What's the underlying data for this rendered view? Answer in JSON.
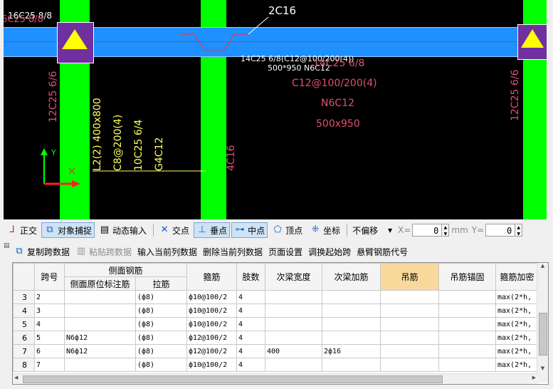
{
  "cad": {
    "top_left_label": "16C25 8/8",
    "top_left_label2": "6C25 8/8",
    "beam_callout": "2C16",
    "beam_dim_white1": "14C25 6/8(C12@100/200(4))",
    "beam_dim_white2": "500*950 N6C12",
    "beam_red1": "14C25 6/8",
    "beam_red2": "C12@100/200(4)",
    "beam_red3": "N6C12",
    "beam_red4": "500x950",
    "col_left_label": "12C25 6/6",
    "col_right_label": "12C25 6/6",
    "col_mid_label": "4C16",
    "l2_lines": [
      "L2(2) 400x800",
      "C8@200(4)",
      "10C25 6/4",
      "G4C12"
    ],
    "axis_y": "Y",
    "axis_x": "X"
  },
  "toolbar1": {
    "ortho": "正交",
    "snap": "对象捕捉",
    "dynamic": "动态输入",
    "intersect": "交点",
    "perp": "垂点",
    "mid": "中点",
    "vertex": "顶点",
    "coord": "坐标",
    "offset": "不偏移",
    "x_label": "X=",
    "x_value": "0",
    "mm": "mm",
    "y_label": "Y=",
    "y_value": "0"
  },
  "toolbar2": {
    "copy": "复制跨数据",
    "paste": "粘贴跨数据",
    "input_col": "输入当前列数据",
    "delete_col": "删除当前列数据",
    "page_setup": "页面设置",
    "swap_start": "调换起始跨",
    "cantilever": "悬臂钢筋代号"
  },
  "grid": {
    "headers": {
      "span": "跨号",
      "side": "侧面钢筋",
      "side_orig": "侧面原位标注筋",
      "tie": "拉筋",
      "stirrup": "箍筋",
      "legs": "肢数",
      "sec_width": "次梁宽度",
      "sec_add": "次梁加筋",
      "hanger": "吊筋",
      "hanger_anchor": "吊筋锚固",
      "stirrup_dense": "箍筋加密"
    },
    "rows": [
      {
        "n": "3",
        "span": "2",
        "side": "",
        "tie": "(ф8)",
        "stirrup": "ф10@100/2",
        "legs": "4",
        "sw": "",
        "sa": "",
        "h": "",
        "ha": "",
        "sd": "max(2*h,"
      },
      {
        "n": "4",
        "span": "3",
        "side": "",
        "tie": "(ф8)",
        "stirrup": "ф10@100/2",
        "legs": "4",
        "sw": "",
        "sa": "",
        "h": "",
        "ha": "",
        "sd": "max(2*h,"
      },
      {
        "n": "5",
        "span": "4",
        "side": "",
        "tie": "(ф8)",
        "stirrup": "ф10@100/2",
        "legs": "4",
        "sw": "",
        "sa": "",
        "h": "",
        "ha": "",
        "sd": "max(2*h,"
      },
      {
        "n": "6",
        "span": "5",
        "side": "N6ф12",
        "tie": "(ф8)",
        "stirrup": "ф12@100/2",
        "legs": "4",
        "sw": "",
        "sa": "",
        "h": "",
        "ha": "",
        "sd": "max(2*h,"
      },
      {
        "n": "7",
        "span": "6",
        "side": "N6ф12",
        "tie": "(ф8)",
        "stirrup": "ф12@100/2",
        "legs": "4",
        "sw": "400",
        "sa": "2ф16",
        "h": "",
        "ha": "",
        "sd": "max(2*h,"
      },
      {
        "n": "8",
        "span": "7",
        "side": "",
        "tie": "(ф8)",
        "stirrup": "ф10@100/2",
        "legs": "4",
        "sw": "",
        "sa": "",
        "h": "",
        "ha": "",
        "sd": "max(2*h,"
      }
    ]
  }
}
